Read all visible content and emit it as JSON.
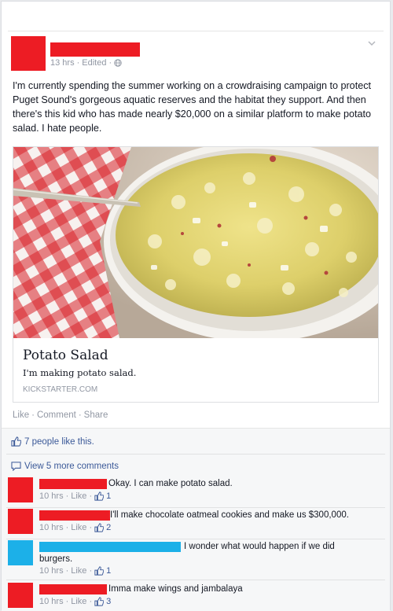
{
  "post": {
    "time": "13 hrs",
    "edited": "Edited",
    "dot": "·",
    "text": "I'm currently spending the summer working on a crowdraising campaign to protect Puget Sound's gorgeous aquatic reserves and the habitat they support. And then there's this kid who has made nearly $20,000 on a similar platform to make potato salad. I hate people."
  },
  "attachment": {
    "title": "Potato Salad",
    "description": "I'm making potato salad.",
    "domain": "KICKSTARTER.COM"
  },
  "actions": {
    "like": "Like",
    "comment": "Comment",
    "share": "Share",
    "dot": "·"
  },
  "likes": {
    "text": "7 people like this."
  },
  "more_comments": {
    "text": "View 5 more comments"
  },
  "colors": {
    "redaction_red": "#ed1c24",
    "redaction_blue": "#1cb0e8",
    "link_blue": "#3b5998"
  },
  "comments": [
    {
      "text": "Okay. I can make potato salad.",
      "time": "10 hrs",
      "like": "Like",
      "count": "1"
    },
    {
      "text": "I'll make chocolate oatmeal cookies and make us $300,000.",
      "time": "10 hrs",
      "like": "Like",
      "count": "2"
    },
    {
      "text_a": "I wonder what would happen if we did",
      "text_b": "burgers.",
      "time": "10 hrs",
      "like": "Like",
      "count": "1"
    },
    {
      "text": "Imma make wings and jambalaya",
      "time": "10 hrs",
      "like": "Like",
      "count": "3"
    }
  ]
}
